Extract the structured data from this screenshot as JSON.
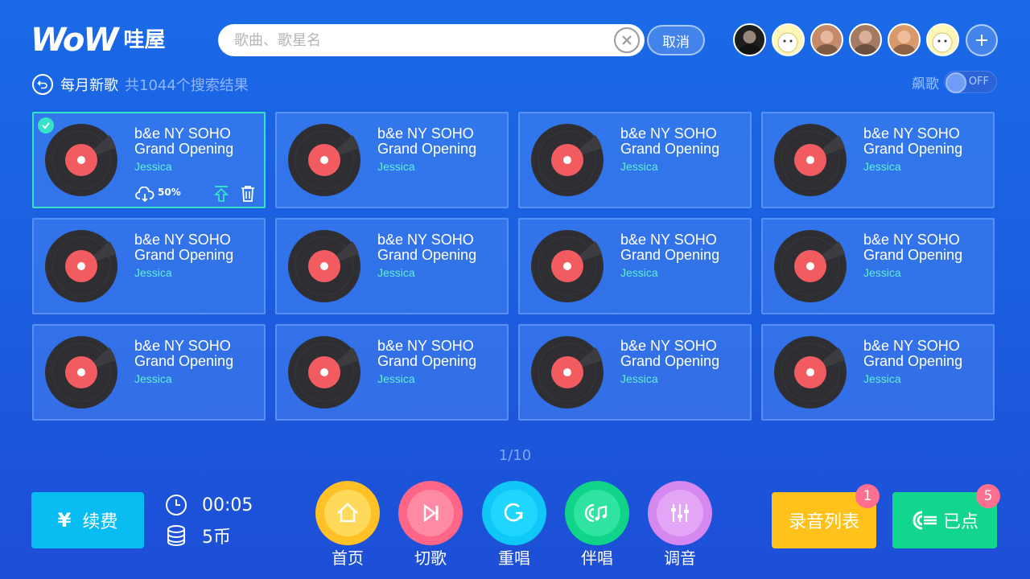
{
  "app": {
    "logo_text": "WoW",
    "logo_cn": "哇屋"
  },
  "search": {
    "placeholder": "歌曲、歌星名",
    "value": "",
    "cancel_label": "取消"
  },
  "avatars": [
    {
      "name": "avatar-1",
      "bg": "#1d1d1d"
    },
    {
      "name": "avatar-2",
      "bg": "#fff6b8"
    },
    {
      "name": "avatar-3",
      "bg": "#c48a6a"
    },
    {
      "name": "avatar-4",
      "bg": "#a57a62"
    },
    {
      "name": "avatar-5",
      "bg": "#d89a6a"
    },
    {
      "name": "avatar-6",
      "bg": "#fff6b8"
    }
  ],
  "subheader": {
    "title": "每月新歌",
    "result_count": "共1044个搜索结果",
    "toggle_label": "飙歌",
    "toggle_state": "OFF"
  },
  "songs": [
    {
      "title": "b&e NY SOHO Grand Opening",
      "singer": "Jessica",
      "selected": true,
      "download_pct": "50%"
    },
    {
      "title": "b&e NY SOHO Grand Opening",
      "singer": "Jessica"
    },
    {
      "title": "b&e NY SOHO Grand Opening",
      "singer": "Jessica"
    },
    {
      "title": "b&e NY SOHO Grand Opening",
      "singer": "Jessica"
    },
    {
      "title": "b&e NY SOHO Grand Opening",
      "singer": "Jessica"
    },
    {
      "title": "b&e NY SOHO Grand Opening",
      "singer": "Jessica"
    },
    {
      "title": "b&e NY SOHO Grand Opening",
      "singer": "Jessica"
    },
    {
      "title": "b&e NY SOHO Grand Opening",
      "singer": "Jessica"
    },
    {
      "title": "b&e NY SOHO Grand Opening",
      "singer": "Jessica"
    },
    {
      "title": "b&e NY SOHO Grand Opening",
      "singer": "Jessica"
    },
    {
      "title": "b&e NY SOHO Grand Opening",
      "singer": "Jessica"
    },
    {
      "title": "b&e NY SOHO Grand Opening",
      "singer": "Jessica"
    }
  ],
  "pager": {
    "text": "1/10"
  },
  "bottom": {
    "renew": {
      "symbol": "¥",
      "label": "续费"
    },
    "timer": "00:05",
    "coins": "5币",
    "controls": [
      {
        "key": "home",
        "label": "首页",
        "outer": "#ffc125",
        "inner": "#ffd95a"
      },
      {
        "key": "next",
        "label": "切歌",
        "outer": "#ff6688",
        "inner": "#ff8aa5"
      },
      {
        "key": "replay",
        "label": "重唱",
        "outer": "#0fc8f7",
        "inner": "#20d6ff"
      },
      {
        "key": "accompany",
        "label": "伴唱",
        "outer": "#10d488",
        "inner": "#2fe3a0"
      },
      {
        "key": "tune",
        "label": "调音",
        "outer": "#d589f0",
        "inner": "#e3a6f7"
      }
    ],
    "record_list": {
      "label": "录音列表",
      "badge": "1"
    },
    "queued": {
      "label": "已点",
      "badge": "5"
    }
  },
  "colors": {
    "accent_teal": "#35e3c6",
    "bg_blue": "#1b5fe0",
    "singer_text": "#5ef0d8"
  }
}
